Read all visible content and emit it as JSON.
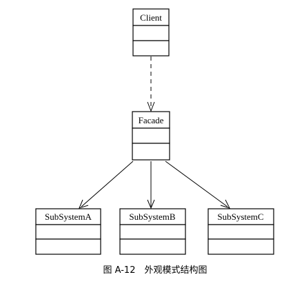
{
  "diagram": {
    "classes": [
      {
        "id": "client",
        "name": "Client"
      },
      {
        "id": "facade",
        "name": "Facade"
      },
      {
        "id": "subsystem-a",
        "name": "SubSystemA"
      },
      {
        "id": "subsystem-b",
        "name": "SubSystemB"
      },
      {
        "id": "subsystem-c",
        "name": "SubSystemC"
      }
    ],
    "relationships": [
      {
        "from": "client",
        "to": "facade",
        "style": "dashed",
        "arrow": "open"
      },
      {
        "from": "facade",
        "to": "subsystem-a",
        "style": "solid",
        "arrow": "open"
      },
      {
        "from": "facade",
        "to": "subsystem-b",
        "style": "solid",
        "arrow": "open"
      },
      {
        "from": "facade",
        "to": "subsystem-c",
        "style": "solid",
        "arrow": "open"
      }
    ]
  },
  "caption": "图 A-12　外观模式结构图"
}
